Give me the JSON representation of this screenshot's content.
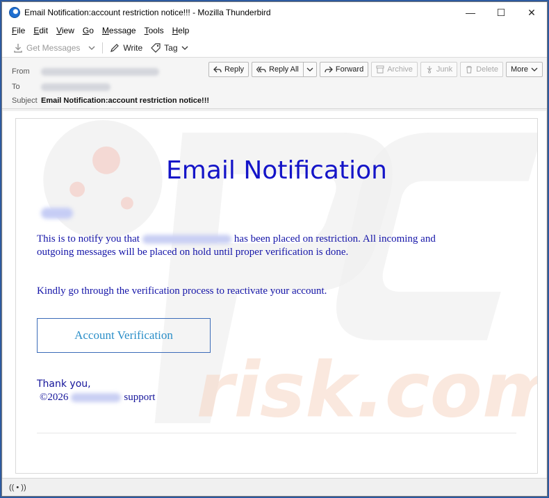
{
  "window": {
    "title": "Email Notification:account restriction notice!!! - Mozilla Thunderbird",
    "minimize": "—",
    "maximize": "☐",
    "close": "✕"
  },
  "menu": [
    {
      "label": "File",
      "u": "F",
      "rest": "ile"
    },
    {
      "label": "Edit",
      "u": "E",
      "rest": "dit"
    },
    {
      "label": "View",
      "u": "V",
      "rest": "iew"
    },
    {
      "label": "Go",
      "u": "G",
      "rest": "o"
    },
    {
      "label": "Message",
      "u": "M",
      "rest": "essage"
    },
    {
      "label": "Tools",
      "u": "T",
      "rest": "ools"
    },
    {
      "label": "Help",
      "u": "H",
      "rest": "elp"
    }
  ],
  "toolbar": {
    "get_messages": "Get Messages",
    "write": "Write",
    "tag": "Tag"
  },
  "header": {
    "from_label": "From",
    "to_label": "To",
    "subject_label": "Subject",
    "subject": "Email Notification:account restriction notice!!!",
    "actions": {
      "reply": "Reply",
      "reply_all": "Reply All",
      "forward": "Forward",
      "archive": "Archive",
      "junk": "Junk",
      "delete": "Delete",
      "more": "More"
    }
  },
  "message": {
    "title": "Email Notification",
    "para1_before": "This is to notify you that",
    "para1_after": "has been placed on restriction. All incoming and outgoing messages will be placed on hold until proper verification is done.",
    "para2": "Kindly go through the verification process to reactivate your account.",
    "button": "Account Verification",
    "thanks": "Thank you,",
    "copyright_prefix": "©2026",
    "copyright_suffix": "support"
  },
  "watermark": {
    "text": "risk.com"
  },
  "status": {
    "icon": "(( • ))"
  },
  "colors": {
    "title_blue": "#1414c8",
    "body_blue": "#1414a8",
    "button_text": "#2a8ec8",
    "button_border": "#3a6bb8"
  }
}
